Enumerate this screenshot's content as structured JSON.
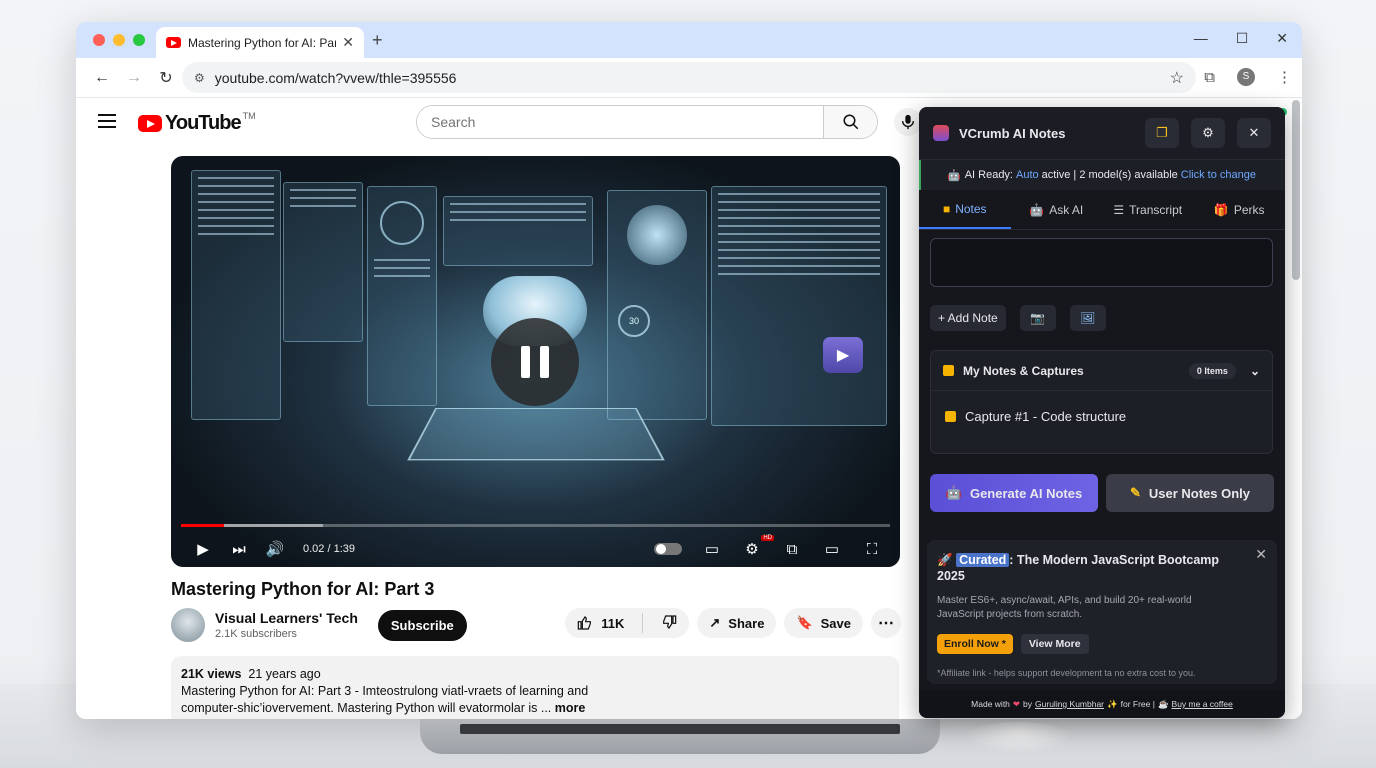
{
  "browser": {
    "tab_title": "Mastering Python for AI: Part 3",
    "url": "youtube.com/watch?vvew/thle=395556",
    "profile_initial": "S",
    "traffic_lights": [
      "#ff5f57",
      "#febc2e",
      "#28c840"
    ]
  },
  "youtube": {
    "logo_text": "YouTube",
    "logo_tm": "TM",
    "search_placeholder": "Search",
    "video": {
      "time": "0.02 / 1:39",
      "progress_fraction": 0.06,
      "buffered_fraction": 0.2,
      "stat_circle": "30"
    },
    "title": "Mastering Python for AI: Part 3",
    "channel": {
      "name": "Visual Learners' Tech",
      "subscribers": "2.1K subscribers",
      "subscribe_label": "Subscribe"
    },
    "actions": {
      "likes": "11K",
      "share": "Share",
      "save": "Save"
    },
    "description": {
      "views": "21K views",
      "age": "21 years ago",
      "line1": "Mastering Python for AI: Part 3 - Imteostrulong viatl-vraets of learning and",
      "line2": "computer-shic’iovervement. Mastering Python will evatormolar is ...",
      "more": "more"
    }
  },
  "panel": {
    "title": "VCrumb AI Notes",
    "status": {
      "prefix": "AI Ready:",
      "mode": "Auto",
      "suffix": "active | 2 model(s) available",
      "change": "Click to change"
    },
    "tabs": [
      "Notes",
      "Ask AI",
      "Transcript",
      "Perks"
    ],
    "add_note": "+ Add Note",
    "notes_header": "My Notes & Captures",
    "notes_count": "0 Items",
    "capture_item": "Capture #1 - Code structure",
    "generate_label": "Generate AI Notes",
    "user_notes_label": "User Notes Only",
    "promo": {
      "tag": "Curated",
      "title": ": The Modern JavaScript Bootcamp 2025",
      "desc": "Master ES6+, async/await, APIs, and build 20+ real-world JavaScript projects from scratch.",
      "enroll": "Enroll Now",
      "view_more": "View More",
      "affiliate": "*Affiliate link - helps support development ta no extra cost to you."
    },
    "footer": {
      "made_with": "Made with",
      "by": "by",
      "author": "Guruling Kumbhar",
      "for_free": "for Free |",
      "coffee": "Buy me a coffee"
    },
    "accent": "#3d7bff"
  }
}
